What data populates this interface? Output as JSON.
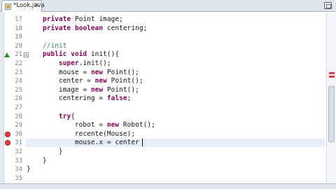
{
  "tab": {
    "label": "*Look.java",
    "close": "✕"
  },
  "lines": [
    {
      "number": "17",
      "text": "    private Point image;"
    },
    {
      "number": "18",
      "text": "    private boolean centering;"
    },
    {
      "number": "19",
      "text": ""
    },
    {
      "number": "20",
      "text": "    //init"
    },
    {
      "number": "21",
      "text": "    public void init(){"
    },
    {
      "number": "22",
      "text": "        super.init();"
    },
    {
      "number": "23",
      "text": "        mouse = new Point();"
    },
    {
      "number": "24",
      "text": "        center = new Point();"
    },
    {
      "number": "25",
      "text": "        image = new Point();"
    },
    {
      "number": "26",
      "text": "        centering = false;"
    },
    {
      "number": "27",
      "text": ""
    },
    {
      "number": "28",
      "text": "        try{"
    },
    {
      "number": "29",
      "text": "            robot = new Robot();"
    },
    {
      "number": "30",
      "text": "            recente(Mouse);"
    },
    {
      "number": "31",
      "text": "            mouse.x = center"
    },
    {
      "number": "32",
      "text": "        }"
    },
    {
      "number": "33",
      "text": "    }"
    },
    {
      "number": "34",
      "text": "}"
    },
    {
      "number": "35",
      "text": ""
    }
  ],
  "current_line": "31",
  "markers": {
    "override_line": "21",
    "error_lines": [
      "30",
      "31"
    ]
  },
  "colors": {
    "keyword": "#7f0055",
    "comment": "#3f7f5f",
    "error": "#e04040",
    "current_line_bg": "#e8f0fc"
  },
  "icons": {
    "tab": "java-file-icon",
    "restore": "restore-icon"
  }
}
